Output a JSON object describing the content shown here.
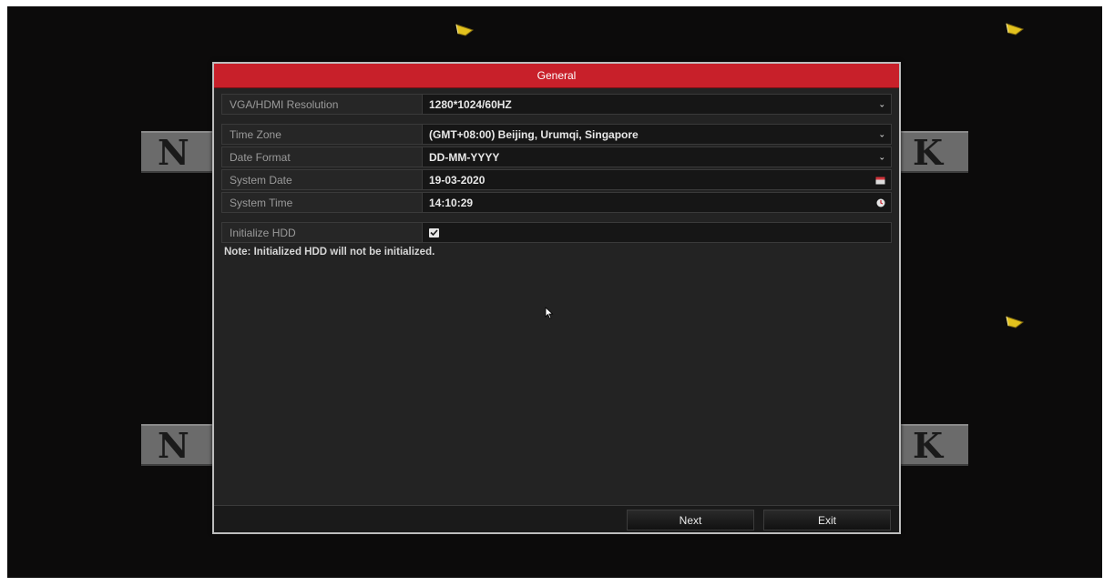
{
  "background": {
    "banner_left": "N",
    "banner_right": "K"
  },
  "dialog": {
    "title": "General",
    "fields": [
      {
        "label": "VGA/HDMI Resolution",
        "value": "1280*1024/60HZ",
        "control": "dropdown"
      },
      {
        "label": "Time Zone",
        "value": "(GMT+08:00) Beijing, Urumqi, Singapore",
        "control": "dropdown"
      },
      {
        "label": "Date Format",
        "value": "DD-MM-YYYY",
        "control": "dropdown"
      },
      {
        "label": "System Date",
        "value": "19-03-2020",
        "control": "calendar-icon"
      },
      {
        "label": "System Time",
        "value": "14:10:29",
        "control": "clock-icon"
      }
    ],
    "initialize_hdd": {
      "label": "Initialize HDD",
      "checked": true
    },
    "note": "Note: Initialized HDD will not be initialized.",
    "buttons": {
      "next": "Next",
      "exit": "Exit"
    }
  },
  "colors": {
    "title_bar": "#c8202a",
    "screen_bg": "#0c0b0b",
    "camera_icon": "#e3c21d"
  }
}
